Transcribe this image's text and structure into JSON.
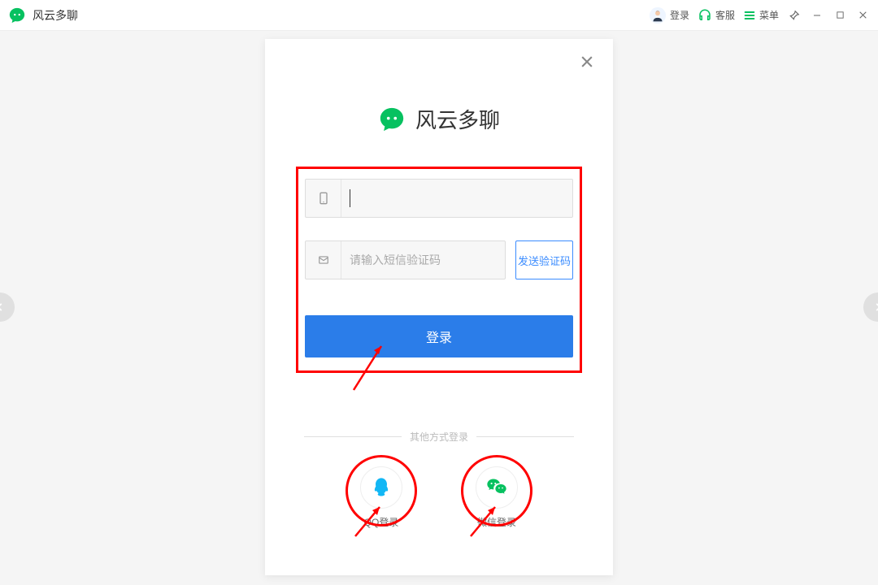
{
  "titlebar": {
    "app_name": "风云多聊",
    "login_label": "登录",
    "support_label": "客服",
    "menu_label": "菜单"
  },
  "dialog": {
    "app_title": "风云多聊",
    "phone_placeholder": "",
    "sms_placeholder": "请输入短信验证码",
    "send_code_label": "发送验证码",
    "login_button_label": "登录",
    "other_login_label": "其他方式登录",
    "qq_label": "QQ登录",
    "wechat_label": "微信登录"
  },
  "colors": {
    "brand_green": "#07c160",
    "primary_blue": "#2b7de9",
    "link_blue": "#3b8cff",
    "annotation_red": "#ff0000",
    "qq_blue": "#12b7f5"
  }
}
